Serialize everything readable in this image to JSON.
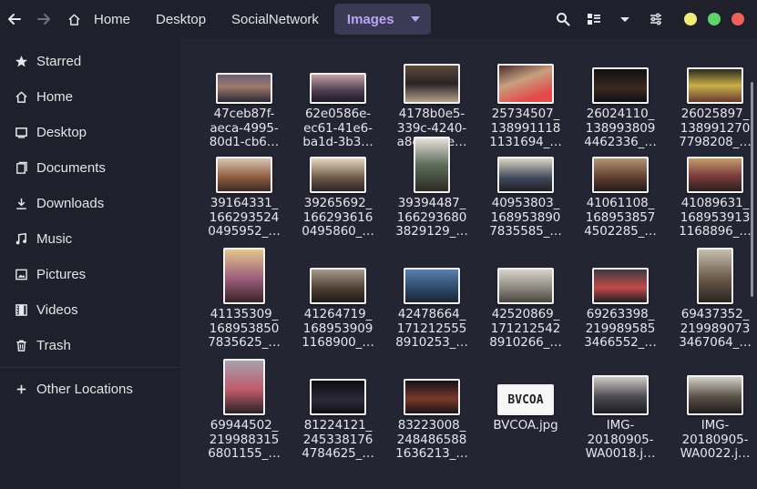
{
  "header": {
    "back_icon": "arrow-left-icon",
    "forward_icon": "arrow-right-icon",
    "breadcrumbs": [
      "Home",
      "Desktop",
      "SocialNetwork",
      "Images"
    ],
    "tools": [
      "search-icon",
      "view-grid-icon",
      "chevron-down-icon",
      "settings-sliders-icon"
    ],
    "window_buttons": [
      "#f2e97c",
      "#5fd46b",
      "#f0605a"
    ],
    "accent": "#b9a6f2"
  },
  "sidebar": {
    "items": [
      {
        "label": "Starred",
        "icon": "star-icon"
      },
      {
        "label": "Home",
        "icon": "home-icon"
      },
      {
        "label": "Desktop",
        "icon": "desktop-icon"
      },
      {
        "label": "Documents",
        "icon": "documents-icon"
      },
      {
        "label": "Downloads",
        "icon": "download-icon"
      },
      {
        "label": "Music",
        "icon": "music-icon"
      },
      {
        "label": "Pictures",
        "icon": "pictures-icon"
      },
      {
        "label": "Videos",
        "icon": "videos-icon"
      },
      {
        "label": "Trash",
        "icon": "trash-icon"
      }
    ],
    "other": {
      "label": "Other Locations",
      "icon": "plus-icon"
    }
  },
  "files": [
    {
      "name": "47ceb87f-\naeca-4995-\n80d1-cb6…"
    },
    {
      "name": "62e0586e-\nec61-41e6-\nba1d-3b3…"
    },
    {
      "name": "4178b0e5-\n339c-4240-\na8e3-58e…"
    },
    {
      "name": "25734507_\n138991118\n1131694_…"
    },
    {
      "name": "26024110_\n138993809\n4462336_…"
    },
    {
      "name": "26025897_\n138991270\n7798208_…"
    },
    {
      "name": "39164331_\n166293524\n0495952_…"
    },
    {
      "name": "39265692_\n166293616\n0495860_…"
    },
    {
      "name": "39394487_\n166293680\n3829129_…"
    },
    {
      "name": "40953803_\n168953890\n7835585_…"
    },
    {
      "name": "41061108_\n168953857\n4502285_…"
    },
    {
      "name": "41089631_\n168953913\n1168896_…"
    },
    {
      "name": "41135309_\n168953850\n7835625_…"
    },
    {
      "name": "41264719_\n168953909\n1168900_…"
    },
    {
      "name": "42478664_\n171212555\n8910253_…"
    },
    {
      "name": "42520869_\n171212542\n8910266_…"
    },
    {
      "name": "69263398_\n219989585\n3466552_…"
    },
    {
      "name": "69437352_\n219989073\n3467064_…"
    },
    {
      "name": "69944502_\n219988315\n6801155_…"
    },
    {
      "name": "81224121_\n245338176\n4784625_…"
    },
    {
      "name": "83223008_\n248486588\n1636213_…"
    },
    {
      "name": "BVCOA.jpg",
      "thumb_text": "BVCOA"
    },
    {
      "name": "IMG-\n20180905-\nWA0018.j…"
    },
    {
      "name": "IMG-\n20180905-\nWA0022.j…"
    }
  ]
}
